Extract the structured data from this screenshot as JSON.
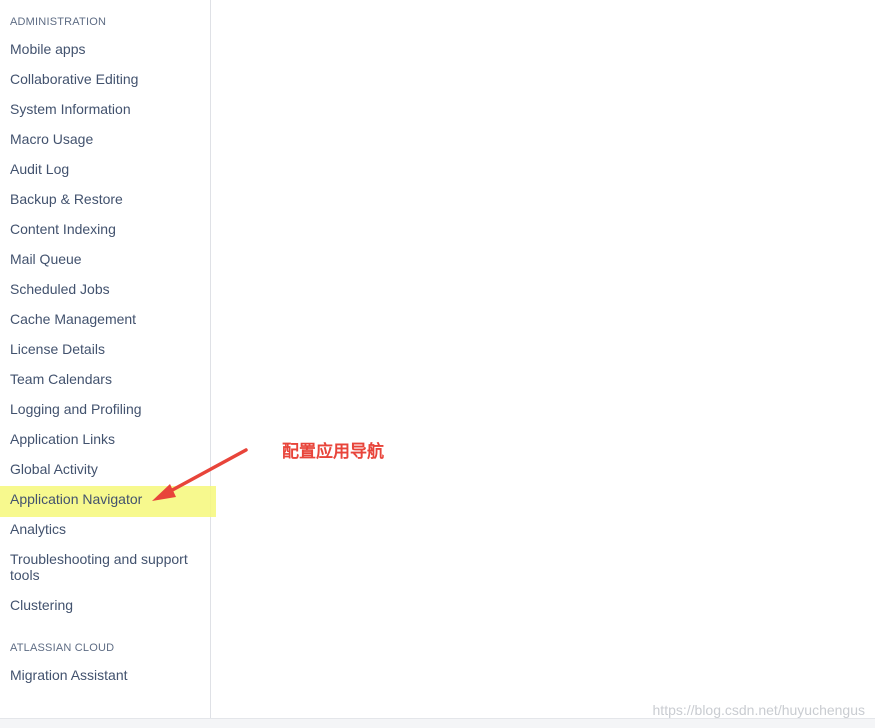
{
  "sidebar": {
    "administration_title": "ADMINISTRATION",
    "items": [
      {
        "label": "Mobile apps"
      },
      {
        "label": "Collaborative Editing"
      },
      {
        "label": "System Information"
      },
      {
        "label": "Macro Usage"
      },
      {
        "label": "Audit Log"
      },
      {
        "label": "Backup & Restore"
      },
      {
        "label": "Content Indexing"
      },
      {
        "label": "Mail Queue"
      },
      {
        "label": "Scheduled Jobs"
      },
      {
        "label": "Cache Management"
      },
      {
        "label": "License Details"
      },
      {
        "label": "Team Calendars"
      },
      {
        "label": "Logging and Profiling"
      },
      {
        "label": "Application Links"
      },
      {
        "label": "Global Activity"
      },
      {
        "label": "Application Navigator"
      },
      {
        "label": "Analytics"
      },
      {
        "label": "Troubleshooting and support tools"
      },
      {
        "label": "Clustering"
      }
    ],
    "cloud_title": "ATLASSIAN CLOUD",
    "cloud_items": [
      {
        "label": "Migration Assistant"
      }
    ]
  },
  "annotation": {
    "text": "配置应用导航",
    "color": "#e8443a"
  },
  "highlight_color": "#f6f87a",
  "watermark": "https://blog.csdn.net/huyuchengus"
}
